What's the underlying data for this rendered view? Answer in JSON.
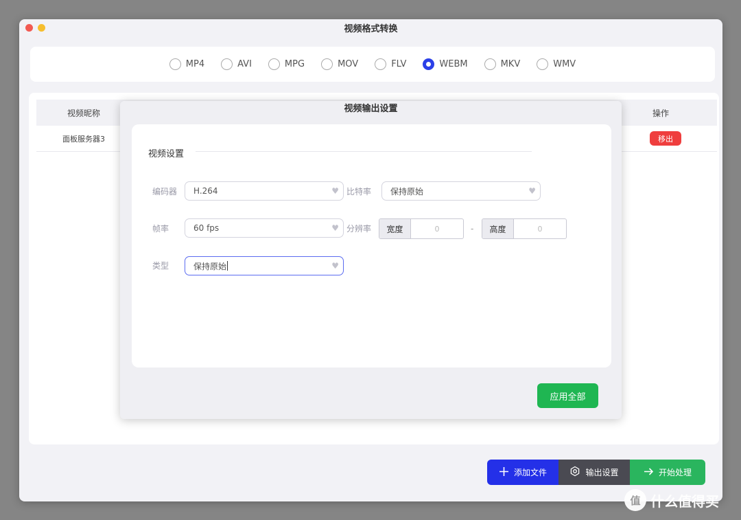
{
  "window": {
    "title": "视频格式转换"
  },
  "formats": [
    {
      "label": "MP4",
      "selected": false
    },
    {
      "label": "AVI",
      "selected": false
    },
    {
      "label": "MPG",
      "selected": false
    },
    {
      "label": "MOV",
      "selected": false
    },
    {
      "label": "FLV",
      "selected": false
    },
    {
      "label": "WEBM",
      "selected": true
    },
    {
      "label": "MKV",
      "selected": false
    },
    {
      "label": "WMV",
      "selected": false
    }
  ],
  "list": {
    "col_name": "视频昵称",
    "col_op": "操作",
    "rows": [
      {
        "name": "面板服务器3",
        "action": "移出"
      }
    ]
  },
  "dialog": {
    "title": "视频输出设置",
    "section": "视频设置",
    "codec_label": "编码器",
    "codec_value": "H.264",
    "bitrate_label": "比特率",
    "bitrate_value": "保持原始",
    "fps_label": "帧率",
    "fps_value": "60 fps",
    "resolution_label": "分辨率",
    "width_tag": "宽度",
    "width_value": "0",
    "height_tag": "高度",
    "height_value": "0",
    "dash": "-",
    "type_label": "类型",
    "type_value": "保持原始",
    "apply_label": "应用全部"
  },
  "actions": {
    "add": "添加文件",
    "output": "输出设置",
    "start": "开始处理"
  },
  "watermark": {
    "text": "什么值得买",
    "badge": "值"
  },
  "colors": {
    "accent": "#2b40e8",
    "danger": "#ef3e3e",
    "success": "#1fb652"
  }
}
